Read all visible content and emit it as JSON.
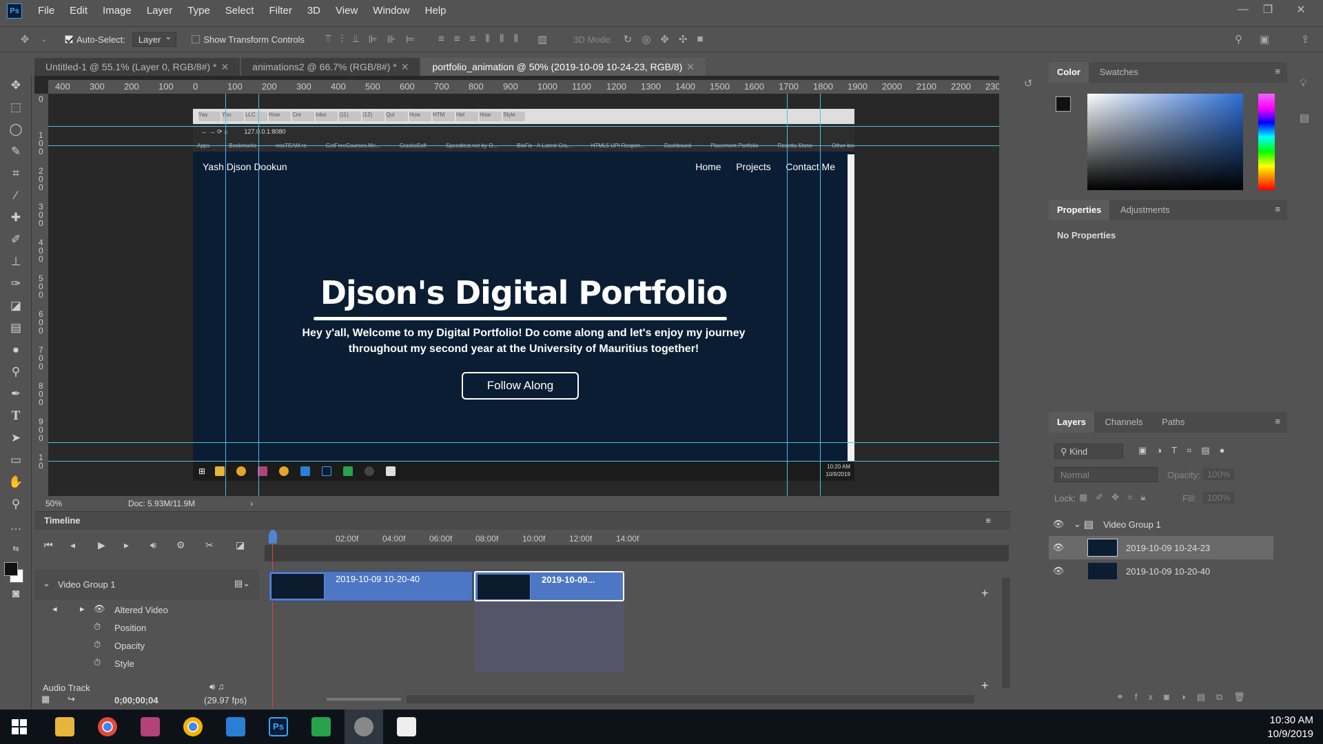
{
  "app": {
    "logo": "Ps"
  },
  "menu": [
    "File",
    "Edit",
    "Image",
    "Layer",
    "Type",
    "Select",
    "Filter",
    "3D",
    "View",
    "Window",
    "Help"
  ],
  "options": {
    "auto_select_label": "Auto-Select:",
    "auto_select_value": "Layer",
    "show_transform_label": "Show Transform Controls",
    "mode_label": "3D Mode:"
  },
  "tabs": [
    {
      "label": "Untitled-1 @ 55.1% (Layer 0, RGB/8#) *"
    },
    {
      "label": "animations2 @ 66.7% (RGB/8#) *"
    },
    {
      "label": "portfolio_animation @ 50% (2019-10-09 10-24-23, RGB/8)"
    }
  ],
  "ruler_h": [
    "400",
    "300",
    "200",
    "100",
    "0",
    "100",
    "200",
    "300",
    "400",
    "500",
    "600",
    "700",
    "800",
    "900",
    "1000",
    "1100",
    "1200",
    "1300",
    "1400",
    "1500",
    "1600",
    "1700",
    "1800",
    "1900",
    "2000",
    "2100",
    "2200",
    "230"
  ],
  "ruler_v": [
    "0",
    "1\n0\n0",
    "2\n0\n0",
    "3\n0\n0",
    "4\n0\n0",
    "5\n0\n0",
    "6\n0\n0",
    "7\n0\n0",
    "8\n0\n0",
    "9\n0\n0",
    "1\n0"
  ],
  "browser": {
    "tabs": [
      "Yas",
      "You",
      "LLC",
      "How",
      "Cre",
      "Inbo",
      "(11)",
      "(12)",
      "Qui",
      "How",
      "HTM",
      "Hel",
      "How",
      "Style"
    ],
    "address": "127.0.0.1:8080",
    "bookmarks": [
      "Apps",
      "Bookmarks",
      "nosTEAM.ro",
      "GetFreeCourses.Me...",
      "CracksSoft",
      "Speedtest.net by O...",
      "BioFic - A Latest Cra...",
      "HTML5 UPI Respon...",
      "Dashboard",
      "Placement Portfolio",
      "Rosetta Stone",
      "Other bookmarks"
    ]
  },
  "site": {
    "brand": "Yash Djson Dookun",
    "links": [
      "Home",
      "Projects",
      "Contact Me"
    ],
    "title": "Djson's Digital Portfolio",
    "subtitle": "Hey y'all, Welcome to my Digital Portfolio! Do come along and let's enjoy my journey throughout my second year at the University of Mauritius together!",
    "button": "Follow Along",
    "taskbar_time": "10:20 AM",
    "taskbar_date": "10/9/2019"
  },
  "status": {
    "zoom": "50%",
    "doc": "Doc: 5.93M/11.9M"
  },
  "timeline": {
    "title": "Timeline",
    "ticks": [
      "02:00f",
      "04:00f",
      "06:00f",
      "08:00f",
      "10:00f",
      "12:00f",
      "14:00f"
    ],
    "group": "Video Group 1",
    "tracks": [
      "Altered Video",
      "Position",
      "Opacity",
      "Style"
    ],
    "clip1": "2019-10-09 10-20-40",
    "clip2": "2019-10-09...",
    "audio": "Audio Track",
    "timecode": "0;00;00;04",
    "fps": "(29.97 fps)"
  },
  "panels": {
    "color_tabs": [
      "Color",
      "Swatches"
    ],
    "prop_tabs": [
      "Properties",
      "Adjustments"
    ],
    "no_props": "No Properties",
    "layer_tabs": [
      "Layers",
      "Channels",
      "Paths"
    ],
    "kind": "Kind",
    "blend": "Normal",
    "opacity_label": "Opacity:",
    "opacity_value": "100%",
    "lock_label": "Lock:",
    "fill_label": "Fill:",
    "fill_value": "100%",
    "layers": [
      "Video Group 1",
      "2019-10-09 10-24-23",
      "2019-10-09 10-20-40"
    ]
  },
  "os": {
    "time": "10:30 AM",
    "date": "10/9/2019"
  },
  "colors": {
    "accent": "#31a8ff",
    "clip": "#4d77c4",
    "guide": "#4fc0e8"
  }
}
